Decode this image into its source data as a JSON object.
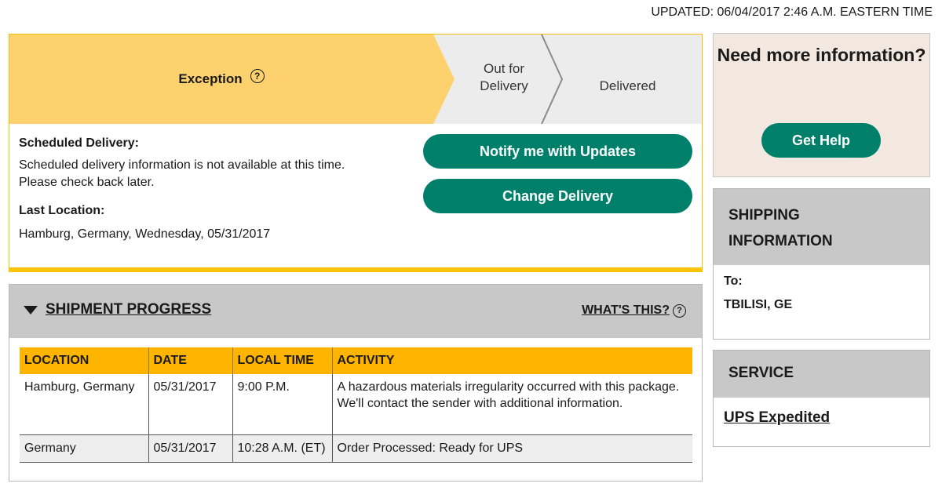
{
  "header": {
    "updated": "UPDATED: 06/04/2017 2:46 A.M. EASTERN TIME"
  },
  "status": {
    "steps": [
      "Exception",
      "Out for\nDelivery",
      "Delivered"
    ],
    "active_step": "Exception",
    "help_glyph": "?",
    "scheduled_heading": "Scheduled Delivery:",
    "scheduled_line1": "Scheduled delivery information is not available at this time.",
    "scheduled_line2": "Please check back later.",
    "last_location_heading": "Last Location:",
    "last_location": "Hamburg, Germany, Wednesday, 05/31/2017",
    "notify_button": "Notify me with Updates",
    "change_button": "Change Delivery"
  },
  "progress": {
    "title": "SHIPMENT PROGRESS",
    "whats_this": "WHAT'S THIS?",
    "columns": [
      "LOCATION",
      "DATE",
      "LOCAL TIME",
      "ACTIVITY"
    ],
    "rows": [
      [
        "Hamburg, Germany",
        "05/31/2017",
        "9:00 P.M.",
        "A hazardous materials irregularity occurred with this package. We'll contact the sender with additional information."
      ],
      [
        "Germany",
        "05/31/2017",
        "10:28 A.M. (ET)",
        "Order Processed: Ready for UPS"
      ]
    ]
  },
  "help_box": {
    "title": "Need more information?",
    "button": "Get Help"
  },
  "shipping": {
    "title": "SHIPPING INFORMATION",
    "to_label": "To:",
    "destination": "TBILISI, GE"
  },
  "service": {
    "title": "SERVICE",
    "value": "UPS Expedited"
  },
  "colors": {
    "accent_yellow": "#ffc400",
    "active_step": "#fdd26e",
    "button_green": "#00806a",
    "panel_gray": "#c8c8c8",
    "help_bg": "#f2e8df"
  },
  "icons": {
    "help": "question-circle-icon",
    "collapse": "triangle-down-icon"
  }
}
